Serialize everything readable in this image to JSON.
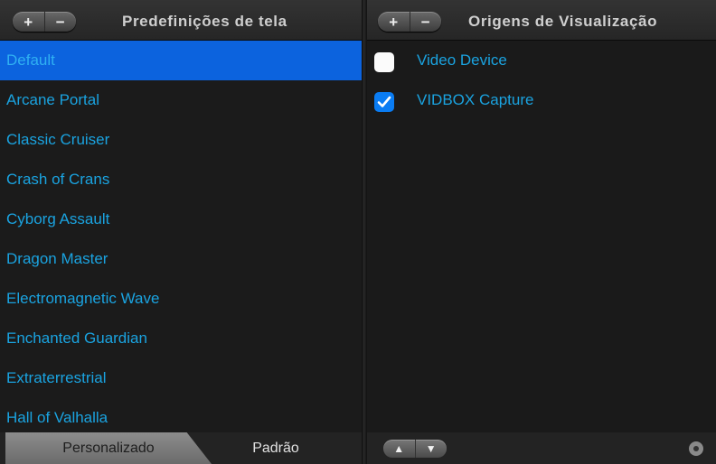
{
  "left_panel": {
    "add_symbol": "+",
    "remove_symbol": "−",
    "title": "Predefinições de tela",
    "presets": [
      "Default",
      "Arcane Portal",
      "Classic Cruiser",
      "Crash of Crans",
      "Cyborg Assault",
      "Dragon Master",
      "Electromagnetic Wave",
      "Enchanted Guardian",
      "Extraterrestrial",
      "Hall of Valhalla"
    ],
    "selected_preset": "Default",
    "tabs": {
      "custom": "Personalizado",
      "default": "Padrão"
    }
  },
  "right_panel": {
    "add_symbol": "+",
    "remove_symbol": "−",
    "title": "Origens de Visualização",
    "sources": [
      {
        "label": "Video Device",
        "checked": false
      },
      {
        "label": "VIDBOX Capture",
        "checked": true
      }
    ],
    "move_up_icon": "arrow-up-icon",
    "move_down_icon": "arrow-down-icon",
    "settings_icon": "gear-icon"
  },
  "colors": {
    "accent_text": "#1aa3e0",
    "selection": "#0c63de",
    "checkbox_checked": "#0a7cf3"
  }
}
